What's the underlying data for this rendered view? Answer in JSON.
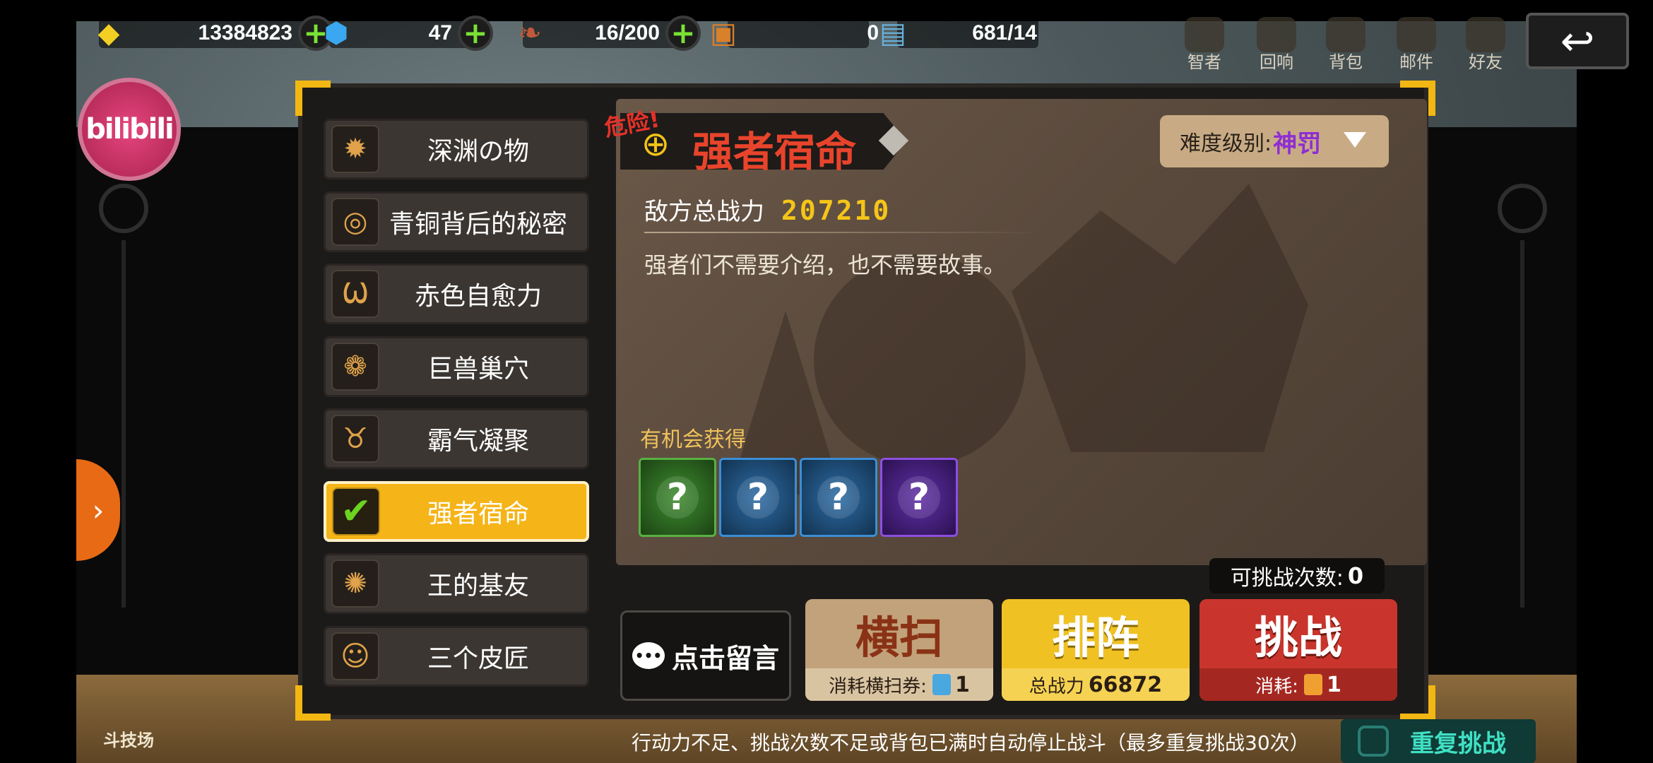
{
  "resources": [
    {
      "icon": "gold-icon",
      "value": "13384823",
      "plus": true
    },
    {
      "icon": "gem-icon",
      "value": "47",
      "plus": true
    },
    {
      "icon": "stamina-icon",
      "value": "16/200",
      "plus": true
    },
    {
      "icon": "card-icon",
      "value": "0",
      "plus": false
    },
    {
      "icon": "book-icon",
      "value": "681/14",
      "plus": false
    }
  ],
  "top_menu": [
    {
      "label": "智者",
      "icon": "sage-icon"
    },
    {
      "label": "回响",
      "icon": "echo-icon"
    },
    {
      "label": "背包",
      "icon": "bag-icon"
    },
    {
      "label": "邮件",
      "icon": "mail-icon"
    },
    {
      "label": "好友",
      "icon": "friends-icon"
    }
  ],
  "watermark": "bilibili",
  "stages": [
    {
      "label": "深渊の物",
      "icon": "sun-icon"
    },
    {
      "label": "青铜背后的秘密",
      "icon": "spiral-icon"
    },
    {
      "label": "赤色自愈力",
      "icon": "fang-icon"
    },
    {
      "label": "巨兽巢穴",
      "icon": "paw-icon"
    },
    {
      "label": "霸气凝聚",
      "icon": "horn-icon"
    },
    {
      "label": "强者宿命",
      "icon": "check-icon",
      "active": true
    },
    {
      "label": "王的基友",
      "icon": "flower-icon"
    },
    {
      "label": "三个皮匠",
      "icon": "person-icon"
    }
  ],
  "detail": {
    "danger": "危险!",
    "title": "强者宿命",
    "difficulty_label": "难度级别:",
    "difficulty_value": "神罚",
    "enemy_power_label": "敌方总战力",
    "enemy_power_value": "207210",
    "description": "强者们不需要介绍，也不需要故事。",
    "reward_label": "有机会获得",
    "rewards": [
      "?",
      "?",
      "?",
      "?"
    ]
  },
  "attempts_label": "可挑战次数:",
  "attempts_value": "0",
  "comment_button": "点击留言",
  "buttons": {
    "sweep": {
      "label": "横扫",
      "sub": "消耗横扫券:",
      "count": "1"
    },
    "lineup": {
      "label": "排阵",
      "sub": "总战力",
      "count": "66872"
    },
    "challenge": {
      "label": "挑战",
      "sub": "消耗:",
      "count": "1"
    }
  },
  "footer_note": "行动力不足、挑战次数不足或背包已满时自动停止战斗（最多重复挑战30次）",
  "repeat_label": "重复挑战",
  "arena_label": "斗技场",
  "colors": {
    "accent": "#f5b417",
    "title_red": "#e8442c",
    "difficulty_purple": "#8e2ed2",
    "challenge_red": "#c9352c"
  }
}
